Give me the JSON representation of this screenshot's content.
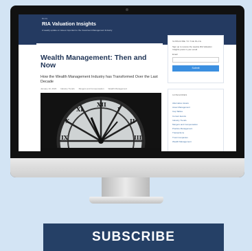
{
  "site": {
    "small_label": "BLOG",
    "title": "RIA Valuation Insights",
    "tagline": "A weekly update on issues important to the Investment Management Industry"
  },
  "article": {
    "title": "Wealth Management: Then and Now",
    "subtitle": "How the Wealth Management Industry has Transformed Over the Last Decade",
    "meta": [
      "January 10, 2023",
      "Industry Trends",
      "Mergers and Compensation",
      "Wealth Management"
    ]
  },
  "sidebar": {
    "subscribe_heading": "SUBSCRIBE TO THE BLOG",
    "subscribe_text": "Sign up to receive the weekly RIA Valuation Insights posts in your email",
    "email_label": "Email",
    "submit_label": "Submit",
    "categories_heading": "CATEGORIES",
    "categories": [
      "Alternative Assets",
      "Asset Management",
      "Cap Tables",
      "Current Events",
      "Industry Trends",
      "Mergers and Compensation",
      "Practice Management",
      "Transactions",
      "Trust Companies",
      "Wealth Management"
    ]
  },
  "cta": {
    "subscribe_label": "SUBSCRIBE"
  },
  "colors": {
    "header": "#243a61",
    "button": "#3b8fe0",
    "cta": "#254066",
    "background": "#d3e4f4"
  }
}
